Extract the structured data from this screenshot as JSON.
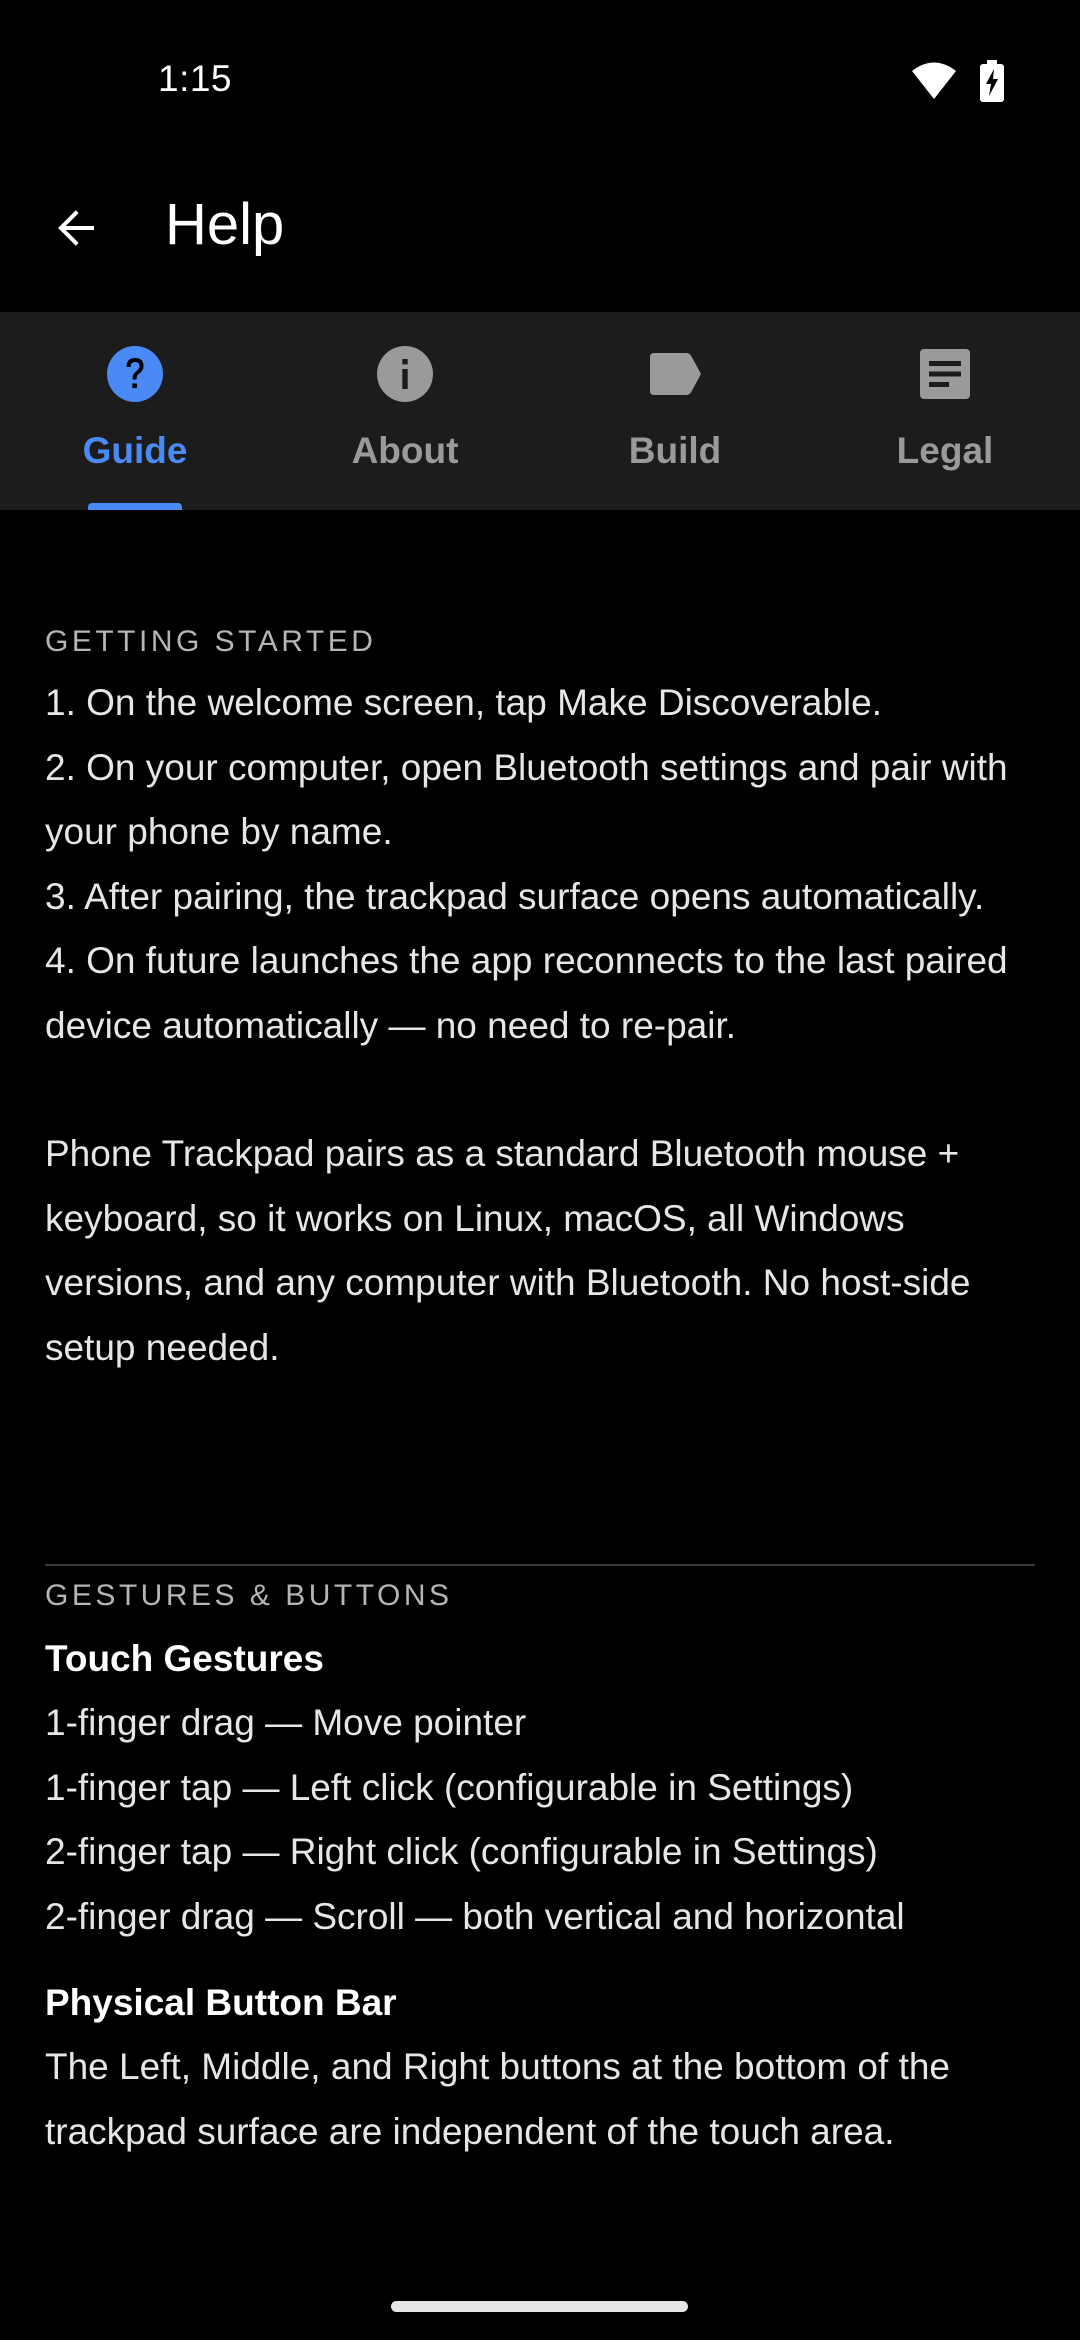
{
  "status_bar": {
    "time": "1:15"
  },
  "app_bar": {
    "title": "Help"
  },
  "tabs": [
    {
      "label": "Guide",
      "icon": "help-circle-icon",
      "active": true
    },
    {
      "label": "About",
      "icon": "info-icon",
      "active": false
    },
    {
      "label": "Build",
      "icon": "label-tag-icon",
      "active": false
    },
    {
      "label": "Legal",
      "icon": "document-icon",
      "active": false
    }
  ],
  "colors": {
    "accent": "#4a8af4",
    "tab_bar_bg": "#1c1c1c",
    "background": "#000000"
  },
  "getting_started": {
    "header": "GETTING STARTED",
    "steps": [
      "1. On the welcome screen, tap Make Discoverable.",
      "2. On your computer, open Bluetooth settings and pair with your phone by name.",
      "3. After pairing, the trackpad surface opens automatically.",
      "4. On future launches the app reconnects to the last paired device automatically — no need to re-pair."
    ],
    "note": "Phone Trackpad pairs as a standard Bluetooth mouse + keyboard, so it works on Linux, macOS, all Windows versions, and any computer with Bluetooth. No host-side setup needed."
  },
  "gestures": {
    "header": "GESTURES & BUTTONS",
    "touch_title": "Touch Gestures",
    "touch_items": [
      "1-finger drag — Move pointer",
      "1-finger tap — Left click (configurable in Settings)",
      "2-finger tap — Right click (configurable in Settings)",
      "2-finger drag — Scroll — both vertical and horizontal"
    ],
    "button_bar_title": "Physical Button Bar",
    "button_bar_text": "The Left, Middle, and Right buttons at the bottom of the trackpad surface are independent of the touch area."
  }
}
